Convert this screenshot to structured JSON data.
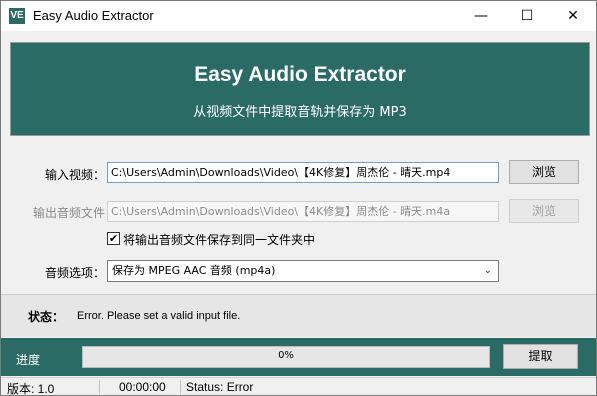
{
  "window": {
    "title": "Easy Audio Extractor",
    "icon_text": "VE",
    "controls": {
      "minimize": "—",
      "maximize": "☐",
      "close": "✕"
    }
  },
  "banner": {
    "title": "Easy Audio Extractor",
    "subtitle": "从视频文件中提取音轨并保存为 MP3",
    "bg_color": "#2b6b66"
  },
  "form": {
    "input_label": "输入视频：",
    "input_value": "C:\\Users\\Admin\\Downloads\\Video\\【4K修复】周杰伦 - 晴天.mp4",
    "browse_input": "浏览",
    "output_label": "输出音频文件",
    "output_value": "C:\\Users\\Admin\\Downloads\\Video\\【4K修复】周杰伦 - 晴天.m4a",
    "browse_output": "浏览",
    "same_folder_checked": true,
    "same_folder_label": "将输出音频文件保存到同一文件夹中",
    "audio_option_label": "音频选项：",
    "audio_option_value": "保存为 MPEG AAC 音频 (mp4a)"
  },
  "status": {
    "label": "状态：",
    "message": "Error. Please set a valid input file."
  },
  "progress": {
    "label": "进度",
    "value": 0,
    "text": "0%",
    "extract_button": "提取"
  },
  "statusbar": {
    "version": "版本: 1.0",
    "time": "00:00:00",
    "state": "Status: Error"
  }
}
